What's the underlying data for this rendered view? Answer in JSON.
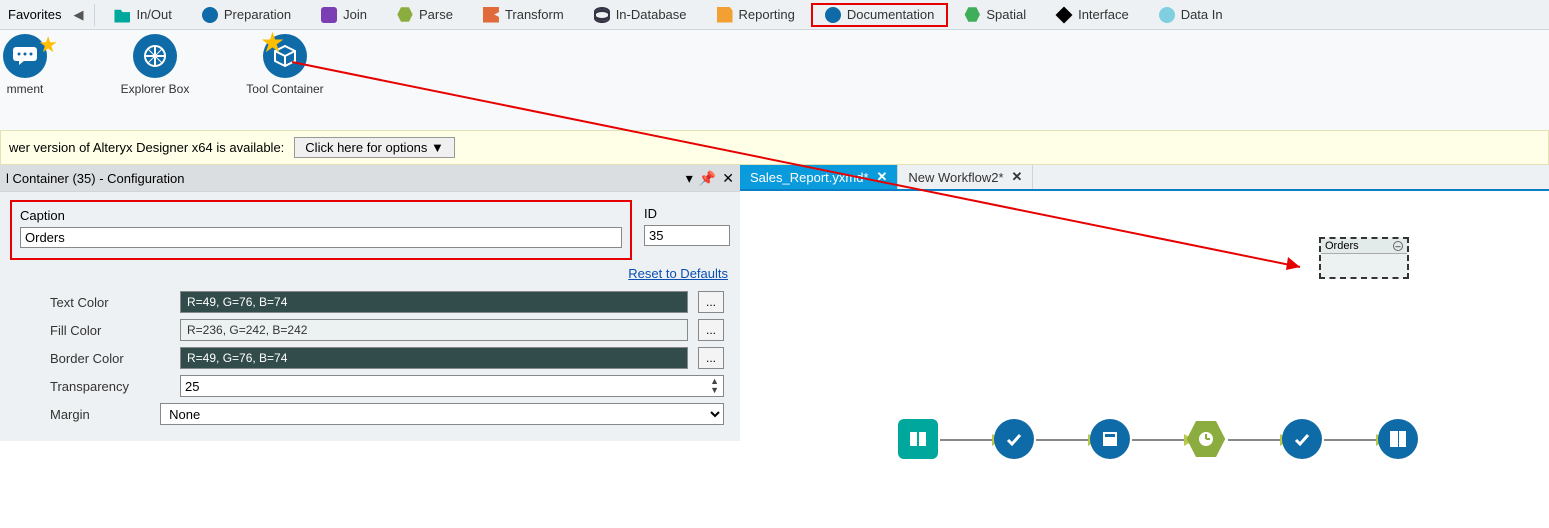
{
  "toolbar": {
    "favorites_label": "Favorites",
    "categories": [
      {
        "label": "In/Out",
        "color": "#00a79d",
        "shape": "ic-folder"
      },
      {
        "label": "Preparation",
        "color": "#0f6aa8",
        "shape": "ic-circle"
      },
      {
        "label": "Join",
        "color": "#7a3fb3",
        "shape": "ic-square"
      },
      {
        "label": "Parse",
        "color": "#8bad3f",
        "shape": "ic-hex"
      },
      {
        "label": "Transform",
        "color": "#e06a3a",
        "shape": "ic-flag"
      },
      {
        "label": "In-Database",
        "color": "#3b4a57",
        "shape": "ic-db"
      },
      {
        "label": "Reporting",
        "color": "#f3a033",
        "shape": "ic-report"
      },
      {
        "label": "Documentation",
        "color": "#0f6aa8",
        "shape": "ic-circle",
        "highlighted": true
      },
      {
        "label": "Spatial",
        "color": "#3fae5a",
        "shape": "ic-hex"
      },
      {
        "label": "Interface",
        "color": "#000000",
        "shape": "ic-rhomb"
      },
      {
        "label": "Data In",
        "color": "#7fcfe0",
        "shape": "ic-circle"
      }
    ]
  },
  "palette": {
    "tools": [
      {
        "label": "mment",
        "name": "comment"
      },
      {
        "label": "Explorer Box",
        "name": "explorer-box"
      },
      {
        "label": "Tool Container",
        "name": "tool-container",
        "starred": true
      }
    ]
  },
  "notification": {
    "text": "wer version of Alteryx Designer x64 is available:",
    "button": "Click here for options ▼"
  },
  "config": {
    "panel_title": "l Container (35) - Configuration",
    "caption_label": "Caption",
    "caption_value": "Orders",
    "id_label": "ID",
    "id_value": "35",
    "reset_link": "Reset to Defaults",
    "text_color_label": "Text Color",
    "text_color_value": "R=49, G=76, B=74",
    "text_color_hex": "#314c4a",
    "fill_color_label": "Fill Color",
    "fill_color_value": "R=236, G=242, B=242",
    "fill_color_hex": "#ecf2f2",
    "border_color_label": "Border Color",
    "border_color_value": "R=49, G=76, B=74",
    "border_color_hex": "#314c4a",
    "transparency_label": "Transparency",
    "transparency_value": "25",
    "margin_label": "Margin",
    "margin_value": "None",
    "picker_label": "..."
  },
  "workflow": {
    "tabs": [
      {
        "label": "Sales_Report.yxmd*",
        "active": true
      },
      {
        "label": "New Workflow2*",
        "active": false
      }
    ],
    "container_caption": "Orders"
  }
}
